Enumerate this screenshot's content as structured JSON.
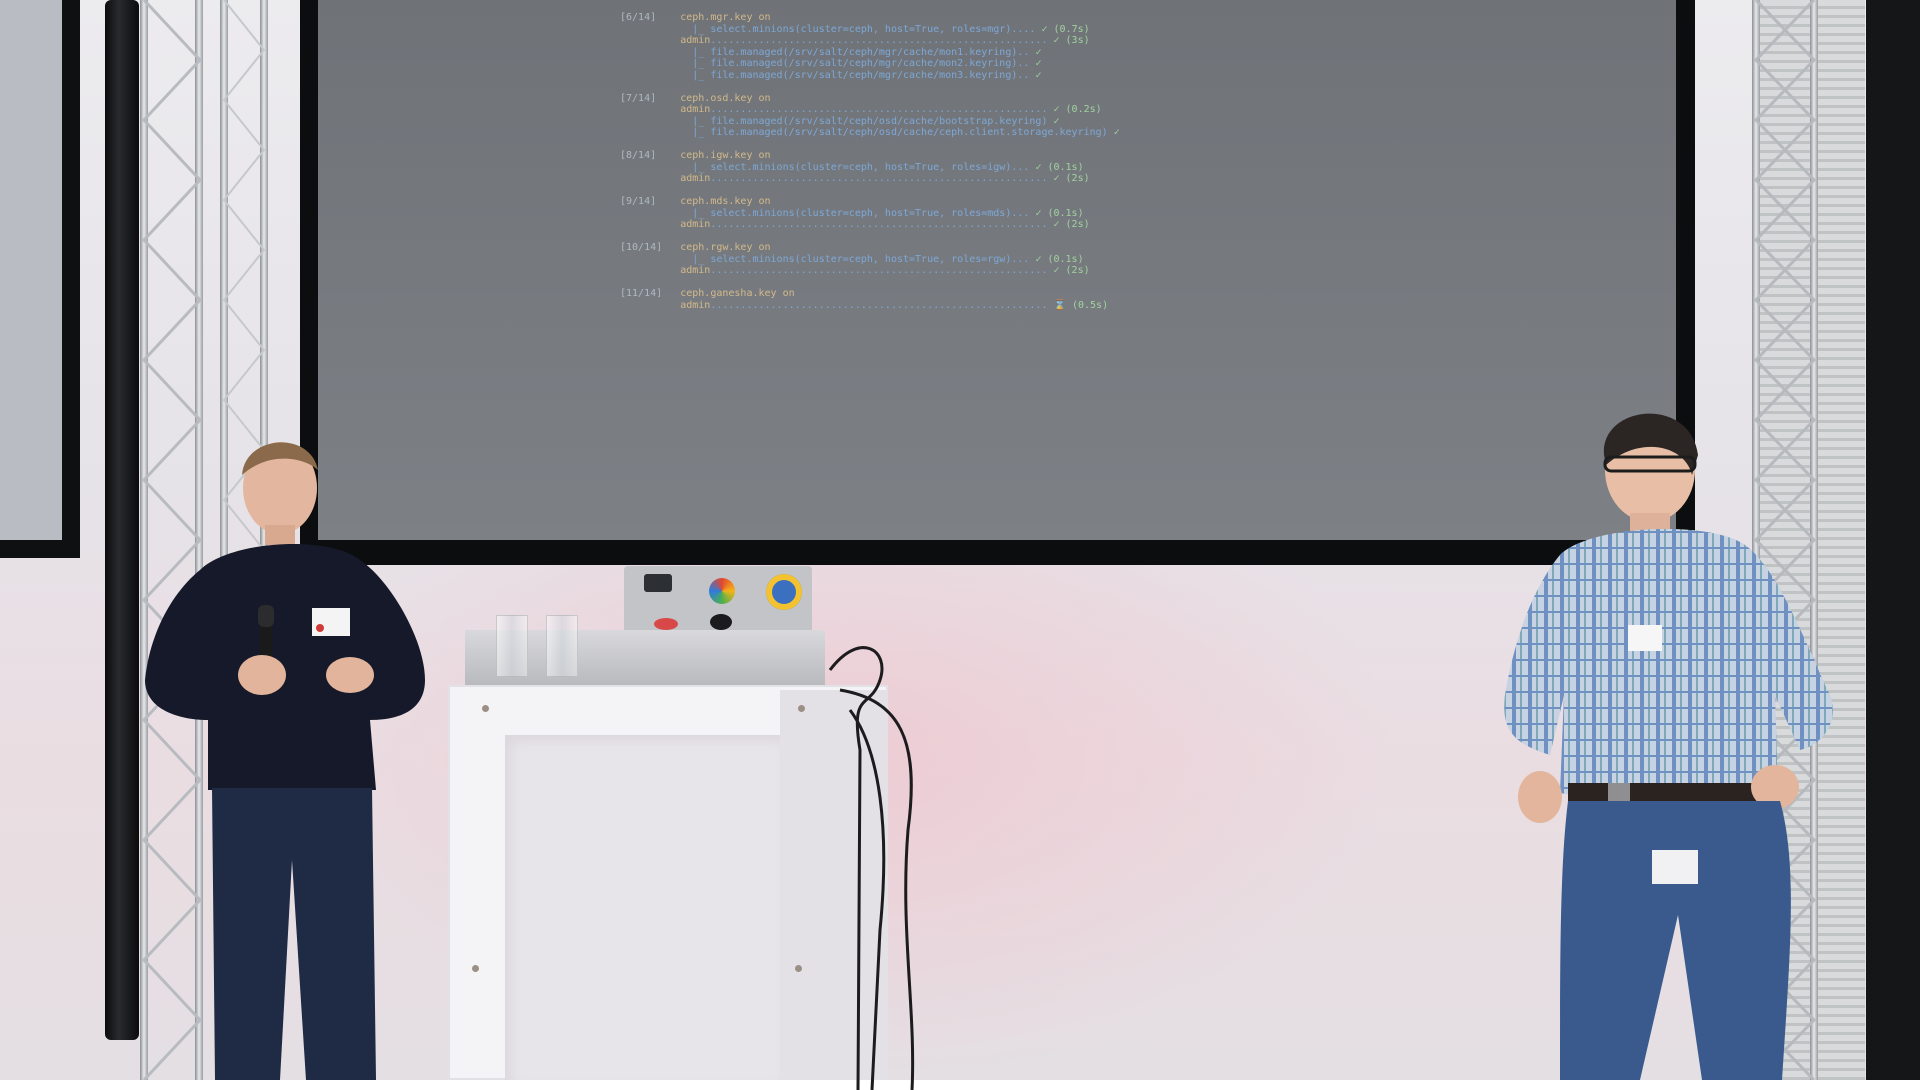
{
  "scene": {
    "description_hidden": "",
    "terminal_lines": [
      {
        "step": "[6/14]",
        "key": "ceph.mgr.key on",
        "cmd": "",
        "ok": ""
      },
      {
        "step": "",
        "key": "",
        "cmd": "|_ select.minions(cluster=ceph, host=True, roles=mgr).... ",
        "ok": "✓ (0.7s)"
      },
      {
        "step": "",
        "key": "admin",
        "cmd": "........................................................ ",
        "ok": "✓ (3s)"
      },
      {
        "step": "",
        "key": "",
        "cmd": "|_ file.managed(/srv/salt/ceph/mgr/cache/mon1.keyring).. ",
        "ok": "✓"
      },
      {
        "step": "",
        "key": "",
        "cmd": "|_ file.managed(/srv/salt/ceph/mgr/cache/mon2.keyring).. ",
        "ok": "✓"
      },
      {
        "step": "",
        "key": "",
        "cmd": "|_ file.managed(/srv/salt/ceph/mgr/cache/mon3.keyring).. ",
        "ok": "✓"
      },
      {
        "step": "",
        "key": "",
        "cmd": "",
        "ok": ""
      },
      {
        "step": "[7/14]",
        "key": "ceph.osd.key on",
        "cmd": "",
        "ok": ""
      },
      {
        "step": "",
        "key": "admin",
        "cmd": "........................................................ ",
        "ok": "✓ (0.2s)"
      },
      {
        "step": "",
        "key": "",
        "cmd": "|_ file.managed(/srv/salt/ceph/osd/cache/bootstrap.keyring) ",
        "ok": "✓"
      },
      {
        "step": "",
        "key": "",
        "cmd": "|_ file.managed(/srv/salt/ceph/osd/cache/ceph.client.storage.keyring) ",
        "ok": "✓"
      },
      {
        "step": "",
        "key": "",
        "cmd": "",
        "ok": ""
      },
      {
        "step": "[8/14]",
        "key": "ceph.igw.key on",
        "cmd": "",
        "ok": ""
      },
      {
        "step": "",
        "key": "",
        "cmd": "|_ select.minions(cluster=ceph, host=True, roles=igw)... ",
        "ok": "✓ (0.1s)"
      },
      {
        "step": "",
        "key": "admin",
        "cmd": "........................................................ ",
        "ok": "✓ (2s)"
      },
      {
        "step": "",
        "key": "",
        "cmd": "",
        "ok": ""
      },
      {
        "step": "[9/14]",
        "key": "ceph.mds.key on",
        "cmd": "",
        "ok": ""
      },
      {
        "step": "",
        "key": "",
        "cmd": "|_ select.minions(cluster=ceph, host=True, roles=mds)... ",
        "ok": "✓ (0.1s)"
      },
      {
        "step": "",
        "key": "admin",
        "cmd": "........................................................ ",
        "ok": "✓ (2s)"
      },
      {
        "step": "",
        "key": "",
        "cmd": "",
        "ok": ""
      },
      {
        "step": "[10/14]",
        "key": "ceph.rgw.key on",
        "cmd": "",
        "ok": ""
      },
      {
        "step": "",
        "key": "",
        "cmd": "|_ select.minions(cluster=ceph, host=True, roles=rgw)... ",
        "ok": "✓ (0.1s)"
      },
      {
        "step": "",
        "key": "admin",
        "cmd": "........................................................ ",
        "ok": "✓ (2s)"
      },
      {
        "step": "",
        "key": "",
        "cmd": "",
        "ok": ""
      },
      {
        "step": "[11/14]",
        "key": "ceph.ganesha.key on",
        "cmd": "",
        "ok": ""
      },
      {
        "step": "",
        "key": "admin",
        "cmd": "........................................................ ",
        "ok": "⌛ (0.5s)"
      }
    ]
  },
  "colors": {
    "wall": "#e9e6ea",
    "screen": "#767a7f",
    "sweater": "#15192a",
    "jeans": "#2f4a78",
    "shirt": "#9fb4cf"
  }
}
